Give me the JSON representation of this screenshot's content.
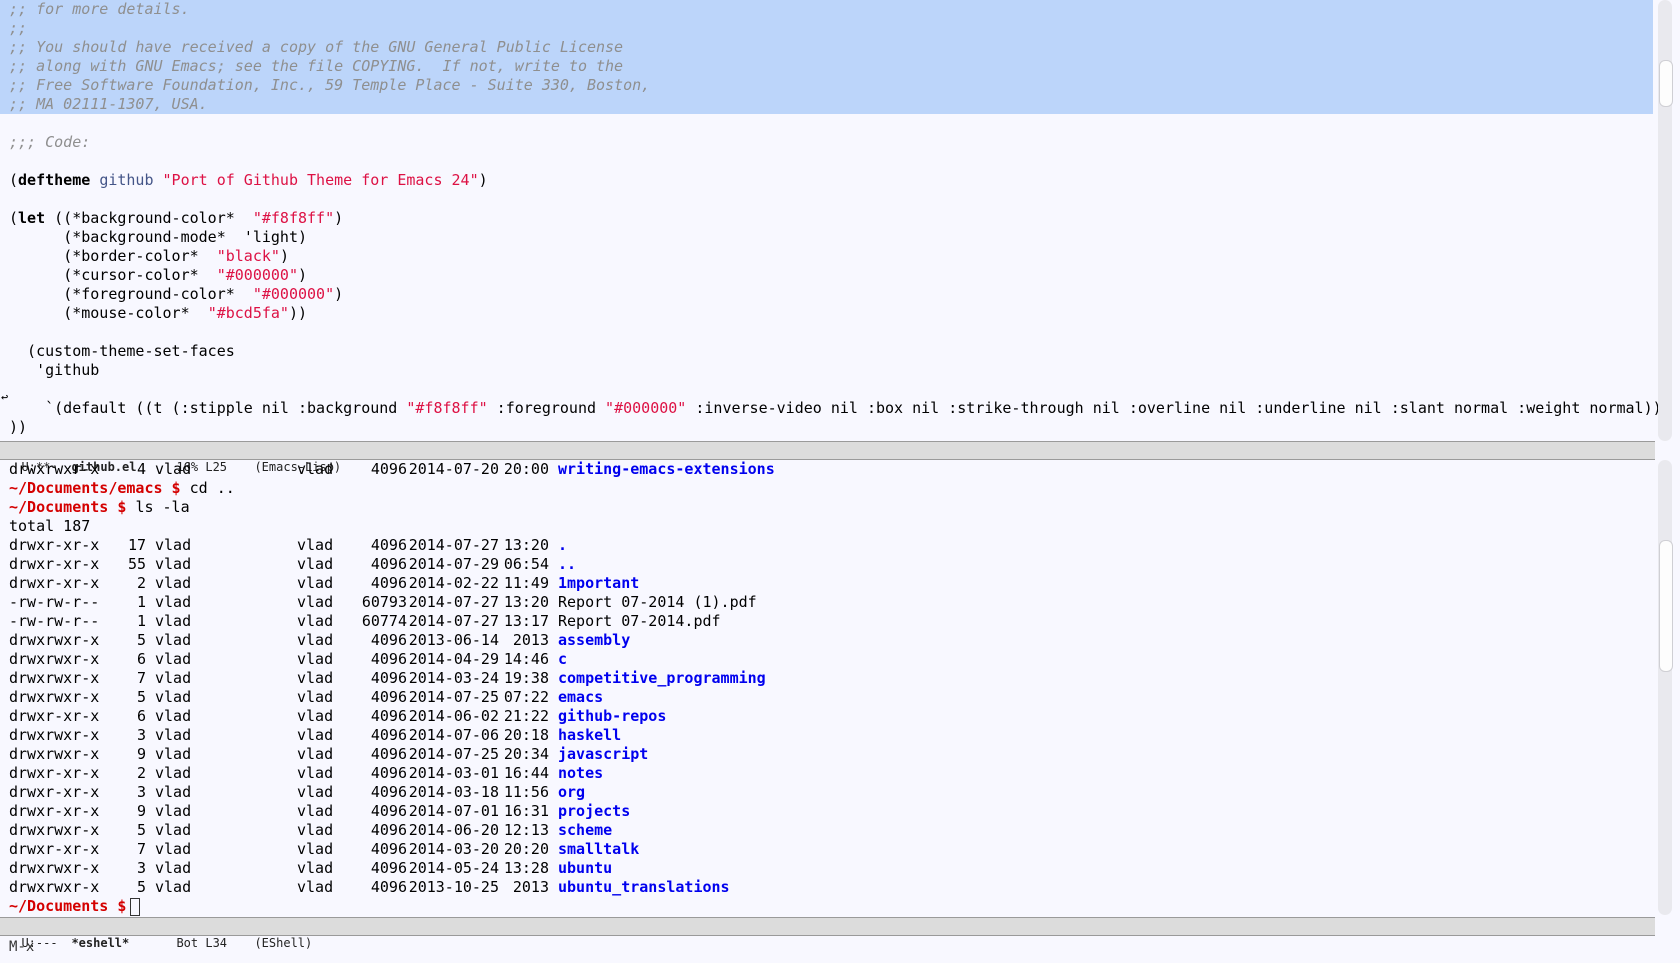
{
  "editor": {
    "comment_lines": [
      ";; for more details.",
      ";;",
      ";; You should have received a copy of the GNU General Public License",
      ";; along with GNU Emacs; see the file COPYING.  If not, write to the",
      ";; Free Software Foundation, Inc., 59 Temple Place - Suite 330, Boston,",
      ";; MA 02111-1307, USA."
    ],
    "code_marker": ";;; Code:",
    "deftheme": {
      "open": "(",
      "keyword": "deftheme",
      "name": "github",
      "doc": "\"Port of Github Theme for Emacs 24\"",
      "close": ")"
    },
    "let_keyword": "let",
    "bindings": [
      {
        "prefix": "(",
        "open": "((",
        "var": "*background-color*",
        "pad": "  ",
        "value": "\"#f8f8ff\"",
        "is_string": true,
        "close": ")"
      },
      {
        "prefix": "      ",
        "open": "(",
        "var": "*background-mode*",
        "pad": "  ",
        "value": "'light",
        "is_string": false,
        "close": ")"
      },
      {
        "prefix": "      ",
        "open": "(",
        "var": "*border-color*",
        "pad": "  ",
        "value": "\"black\"",
        "is_string": true,
        "close": ")"
      },
      {
        "prefix": "      ",
        "open": "(",
        "var": "*cursor-color*",
        "pad": "  ",
        "value": "\"#000000\"",
        "is_string": true,
        "close": ")"
      },
      {
        "prefix": "      ",
        "open": "(",
        "var": "*foreground-color*",
        "pad": "  ",
        "value": "\"#000000\"",
        "is_string": true,
        "close": ")"
      },
      {
        "prefix": "      ",
        "open": "(",
        "var": "*mouse-color*",
        "pad": "  ",
        "value": "\"#bcd5fa\"",
        "is_string": true,
        "close": "))"
      }
    ],
    "custom_faces": "  (custom-theme-set-faces",
    "theme_sym": "   'github",
    "default_face": {
      "pre": "    `(default ((t (:stipple nil :background ",
      "bg": "\"#f8f8ff\"",
      "mid": " :foreground ",
      "fg": "\"#000000\"",
      "post": " :inverse-video nil :box nil :strike-through nil :overline nil :underline nil :slant normal :weight normal))"
    },
    "continuation": "))"
  },
  "top_modeline": {
    "status": "U:**-",
    "buffer": "github.el",
    "position": "16% L25",
    "mode": "(Emacs-Lisp)"
  },
  "shell": {
    "first_entry": {
      "perm": "drwxrwxr-x",
      "n": "4",
      "user": "vlad",
      "group": "vlad",
      "size": "4096",
      "date": "2014-07-20",
      "time": "20:00",
      "name": "writing-emacs-extensions",
      "is_dir": true
    },
    "cmd1": {
      "prompt": "~/Documents/emacs $",
      "command": "cd .."
    },
    "cmd2": {
      "prompt": "~/Documents $",
      "command": "ls -la"
    },
    "total": "total 187",
    "entries": [
      {
        "perm": "drwxr-xr-x",
        "n": "17",
        "user": "vlad",
        "group": "vlad",
        "size": "4096",
        "date": "2014-07-27",
        "time": "13:20",
        "name": ".",
        "is_dir": true
      },
      {
        "perm": "drwxr-xr-x",
        "n": "55",
        "user": "vlad",
        "group": "vlad",
        "size": "4096",
        "date": "2014-07-29",
        "time": "06:54",
        "name": "..",
        "is_dir": true
      },
      {
        "perm": "drwxr-xr-x",
        "n": "2",
        "user": "vlad",
        "group": "vlad",
        "size": "4096",
        "date": "2014-02-22",
        "time": "11:49",
        "name": "1mportant",
        "is_dir": true
      },
      {
        "perm": "-rw-rw-r--",
        "n": "1",
        "user": "vlad",
        "group": "vlad",
        "size": "60793",
        "date": "2014-07-27",
        "time": "13:20",
        "name": "Report 07-2014 (1).pdf",
        "is_dir": false
      },
      {
        "perm": "-rw-rw-r--",
        "n": "1",
        "user": "vlad",
        "group": "vlad",
        "size": "60774",
        "date": "2014-07-27",
        "time": "13:17",
        "name": "Report 07-2014.pdf",
        "is_dir": false
      },
      {
        "perm": "drwxrwxr-x",
        "n": "5",
        "user": "vlad",
        "group": "vlad",
        "size": "4096",
        "date": "2013-06-14",
        "time": "2013",
        "name": "assembly",
        "is_dir": true
      },
      {
        "perm": "drwxrwxr-x",
        "n": "6",
        "user": "vlad",
        "group": "vlad",
        "size": "4096",
        "date": "2014-04-29",
        "time": "14:46",
        "name": "c",
        "is_dir": true
      },
      {
        "perm": "drwxrwxr-x",
        "n": "7",
        "user": "vlad",
        "group": "vlad",
        "size": "4096",
        "date": "2014-03-24",
        "time": "19:38",
        "name": "competitive_programming",
        "is_dir": true
      },
      {
        "perm": "drwxrwxr-x",
        "n": "5",
        "user": "vlad",
        "group": "vlad",
        "size": "4096",
        "date": "2014-07-25",
        "time": "07:22",
        "name": "emacs",
        "is_dir": true
      },
      {
        "perm": "drwxr-xr-x",
        "n": "6",
        "user": "vlad",
        "group": "vlad",
        "size": "4096",
        "date": "2014-06-02",
        "time": "21:22",
        "name": "github-repos",
        "is_dir": true
      },
      {
        "perm": "drwxrwxr-x",
        "n": "3",
        "user": "vlad",
        "group": "vlad",
        "size": "4096",
        "date": "2014-07-06",
        "time": "20:18",
        "name": "haskell",
        "is_dir": true
      },
      {
        "perm": "drwxrwxr-x",
        "n": "9",
        "user": "vlad",
        "group": "vlad",
        "size": "4096",
        "date": "2014-07-25",
        "time": "20:34",
        "name": "javascript",
        "is_dir": true
      },
      {
        "perm": "drwxr-xr-x",
        "n": "2",
        "user": "vlad",
        "group": "vlad",
        "size": "4096",
        "date": "2014-03-01",
        "time": "16:44",
        "name": "notes",
        "is_dir": true
      },
      {
        "perm": "drwxr-xr-x",
        "n": "3",
        "user": "vlad",
        "group": "vlad",
        "size": "4096",
        "date": "2014-03-18",
        "time": "11:56",
        "name": "org",
        "is_dir": true
      },
      {
        "perm": "drwxr-xr-x",
        "n": "9",
        "user": "vlad",
        "group": "vlad",
        "size": "4096",
        "date": "2014-07-01",
        "time": "16:31",
        "name": "projects",
        "is_dir": true
      },
      {
        "perm": "drwxrwxr-x",
        "n": "5",
        "user": "vlad",
        "group": "vlad",
        "size": "4096",
        "date": "2014-06-20",
        "time": "12:13",
        "name": "scheme",
        "is_dir": true
      },
      {
        "perm": "drwxr-xr-x",
        "n": "7",
        "user": "vlad",
        "group": "vlad",
        "size": "4096",
        "date": "2014-03-20",
        "time": "20:20",
        "name": "smalltalk",
        "is_dir": true
      },
      {
        "perm": "drwxrwxr-x",
        "n": "3",
        "user": "vlad",
        "group": "vlad",
        "size": "4096",
        "date": "2014-05-24",
        "time": "13:28",
        "name": "ubuntu",
        "is_dir": true
      },
      {
        "perm": "drwxrwxr-x",
        "n": "5",
        "user": "vlad",
        "group": "vlad",
        "size": "4096",
        "date": "2013-10-25",
        "time": "2013",
        "name": "ubuntu_translations",
        "is_dir": true
      }
    ],
    "final_prompt": "~/Documents $"
  },
  "bottom_modeline": {
    "status": "U:---",
    "buffer": "*eshell*",
    "position": "Bot L34",
    "mode": "(EShell)"
  },
  "minibuffer": {
    "text": "M-x"
  },
  "colors": {
    "background": "#f8f8ff",
    "region": "#bcd5fa",
    "comment": "#8f8f8f",
    "string": "#dd1144",
    "function_name": "#445588",
    "directory": "#0000ee",
    "prompt": "#d40000"
  }
}
